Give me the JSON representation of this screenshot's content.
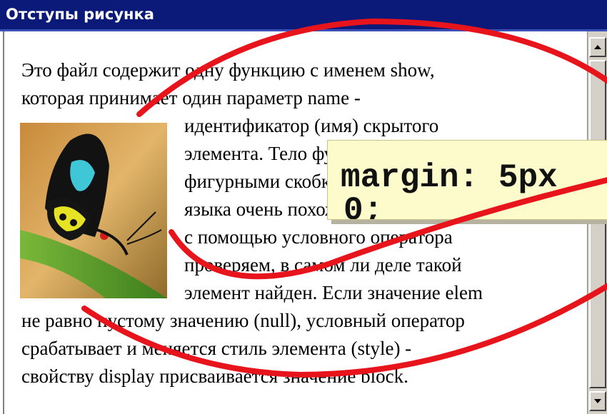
{
  "window": {
    "title": "Отступы рисунка"
  },
  "article": {
    "lines": [
      "Это файл содержит одну функцию с именем show,",
      "которая принимает один параметр name -",
      "идентификатор (имя) скрытого",
      "элемента. Тело функции заключено в",
      "фигурными скобками. Синтаксис",
      "языка очень похож на синтаксис языка C.",
      "с помощью условного оператора",
      "проверяем, в самом ли деле такой",
      "элемент найден. Если значение elem",
      "не равно пустому значению (null), условный оператор",
      "срабатывает и меняется стиль элемента (style) -",
      "свойству display присваивается значение block."
    ]
  },
  "callout": {
    "line1": "margin: 5px",
    "line2": "0;"
  },
  "icons": {
    "image": "butterfly-image",
    "scroll_up": "arrow-up-icon",
    "scroll_down": "arrow-down-icon"
  },
  "colors": {
    "titlebar": "#0b1a78",
    "tooltip_bg": "#fdfbcb",
    "annotation": "#e8141c"
  }
}
